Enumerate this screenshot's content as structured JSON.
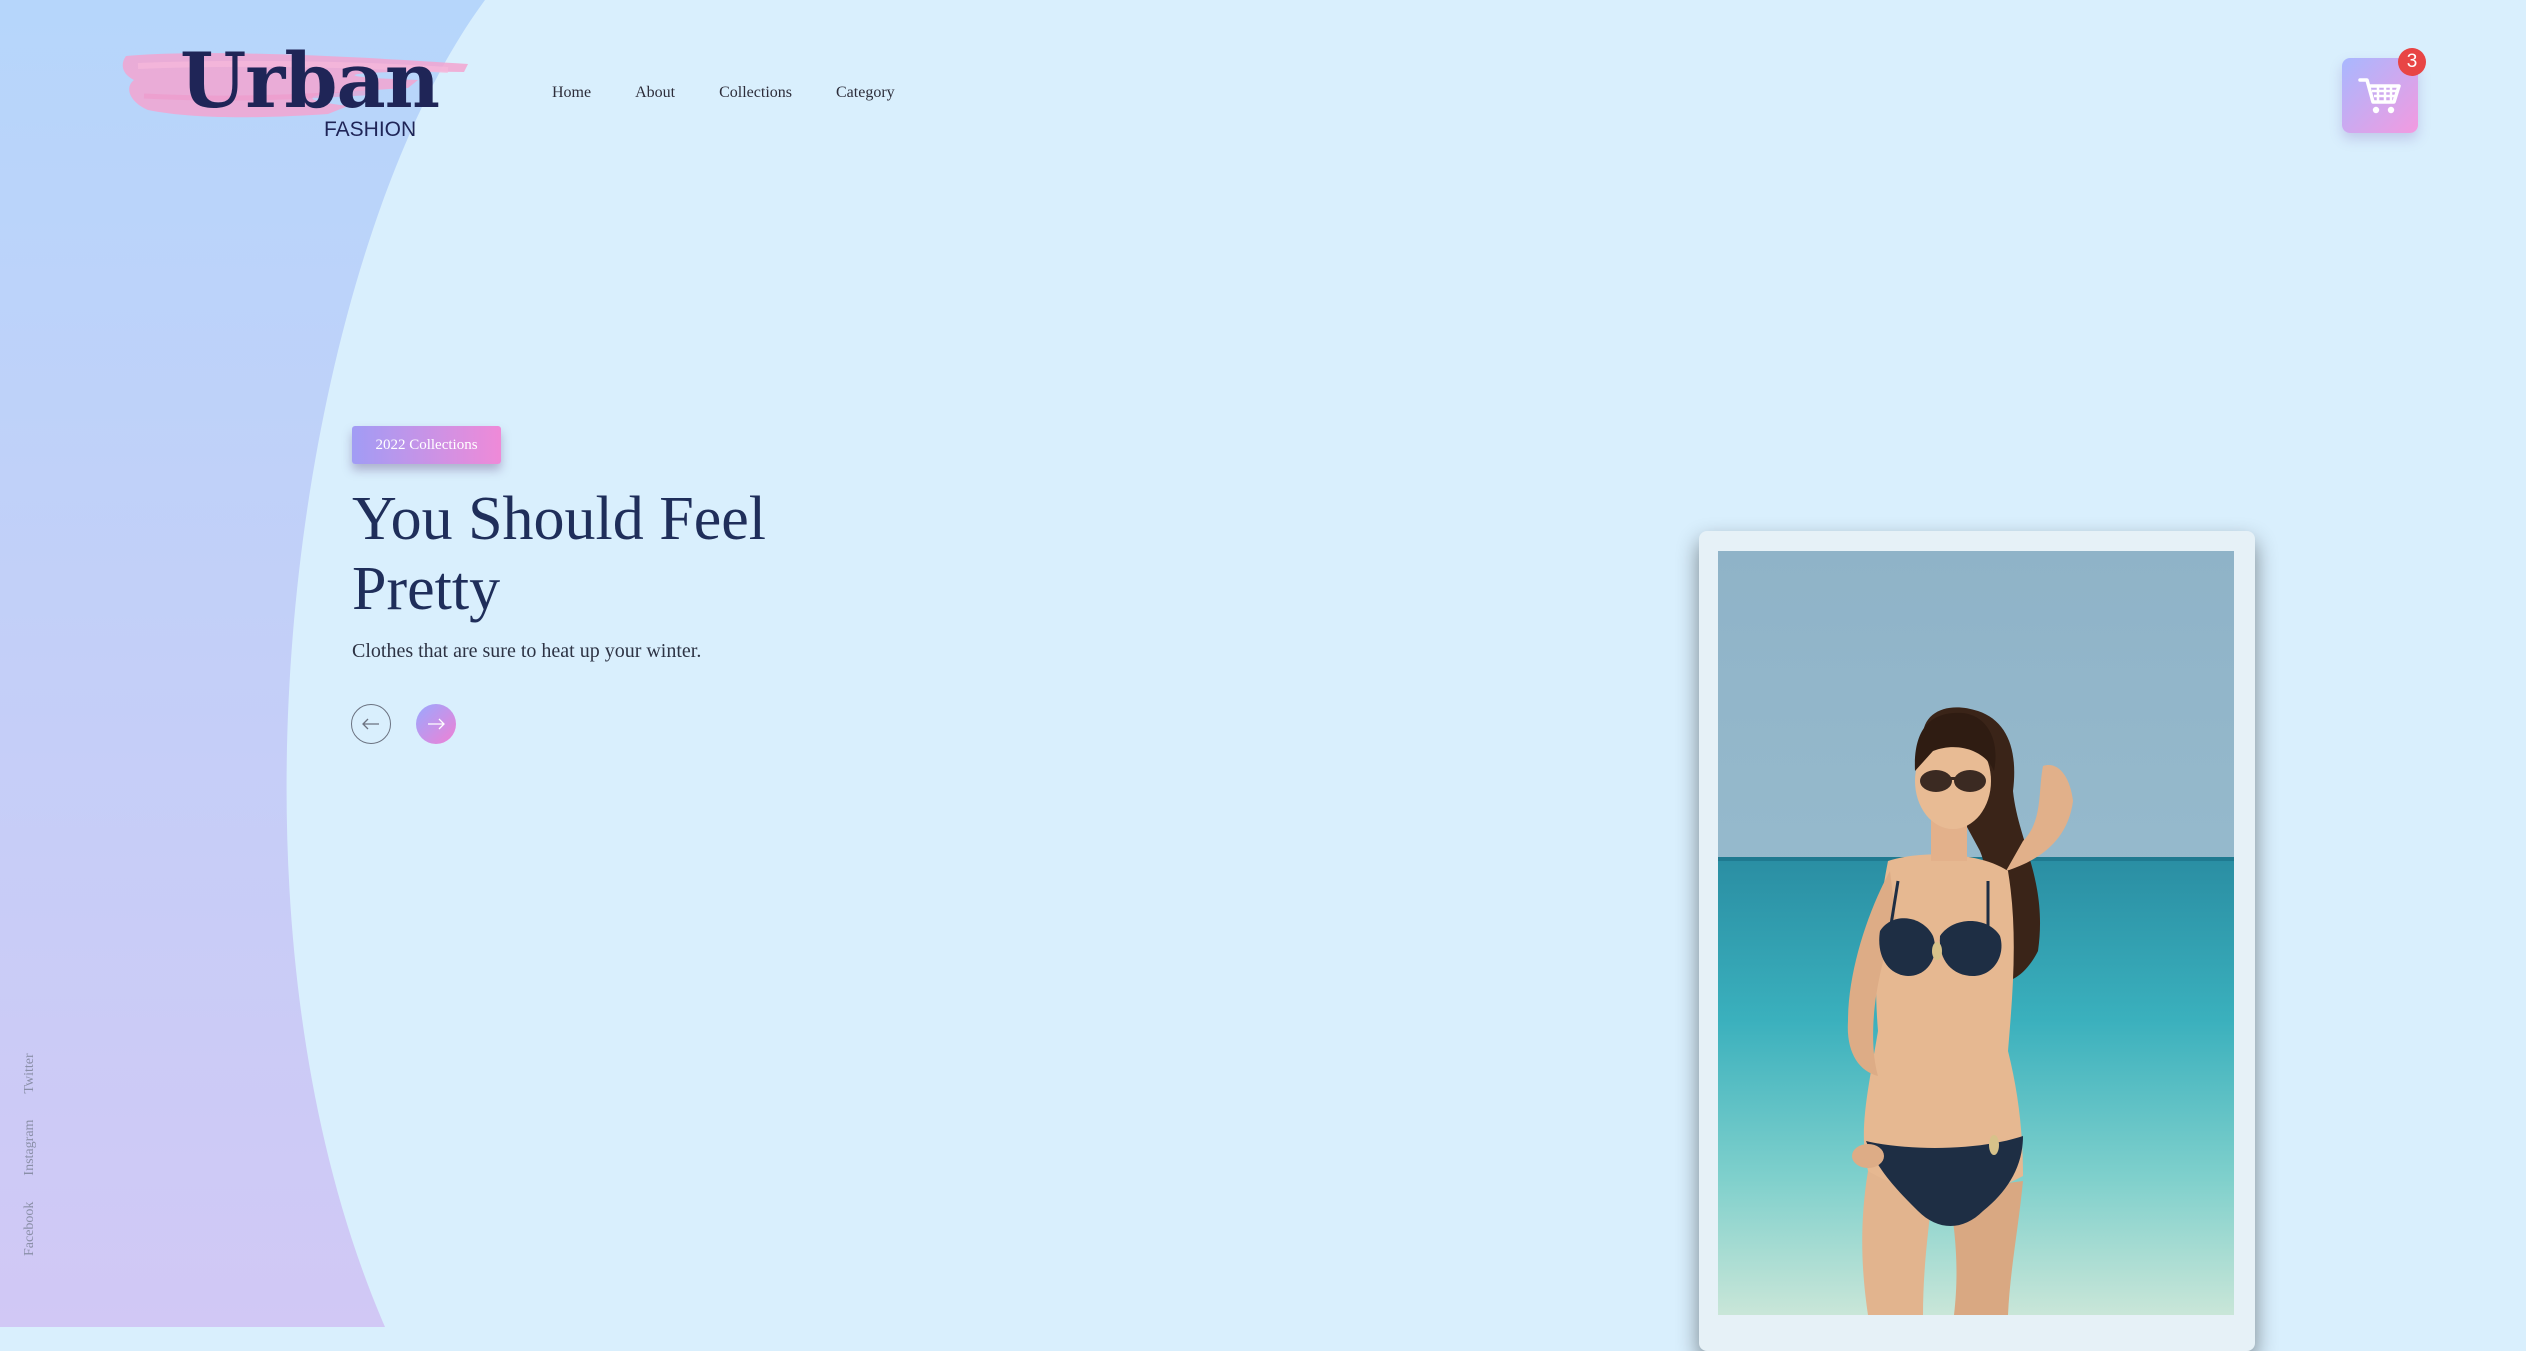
{
  "brand": {
    "name": "Urban",
    "tagline": "FASHION"
  },
  "nav": {
    "items": [
      {
        "label": "Home"
      },
      {
        "label": "About"
      },
      {
        "label": "Collections"
      },
      {
        "label": "Category"
      }
    ]
  },
  "cart": {
    "count": "3",
    "icon": "cart-icon"
  },
  "hero": {
    "badge": "2022 Collections",
    "headline": "You Should Feel Pretty",
    "subtext": "Clothes that are sure to heat up your winter.",
    "prev_icon": "arrow-left-icon",
    "next_icon": "arrow-right-icon"
  },
  "social": {
    "links": [
      {
        "label": "Facebook"
      },
      {
        "label": "Instagram"
      },
      {
        "label": "Twitter"
      }
    ]
  },
  "colors": {
    "background": "#d9effd",
    "brand_navy": "#1f2557",
    "accent_gradient_start": "#a19cf5",
    "accent_gradient_end": "#ef8ad8",
    "badge_red": "#e84545"
  }
}
